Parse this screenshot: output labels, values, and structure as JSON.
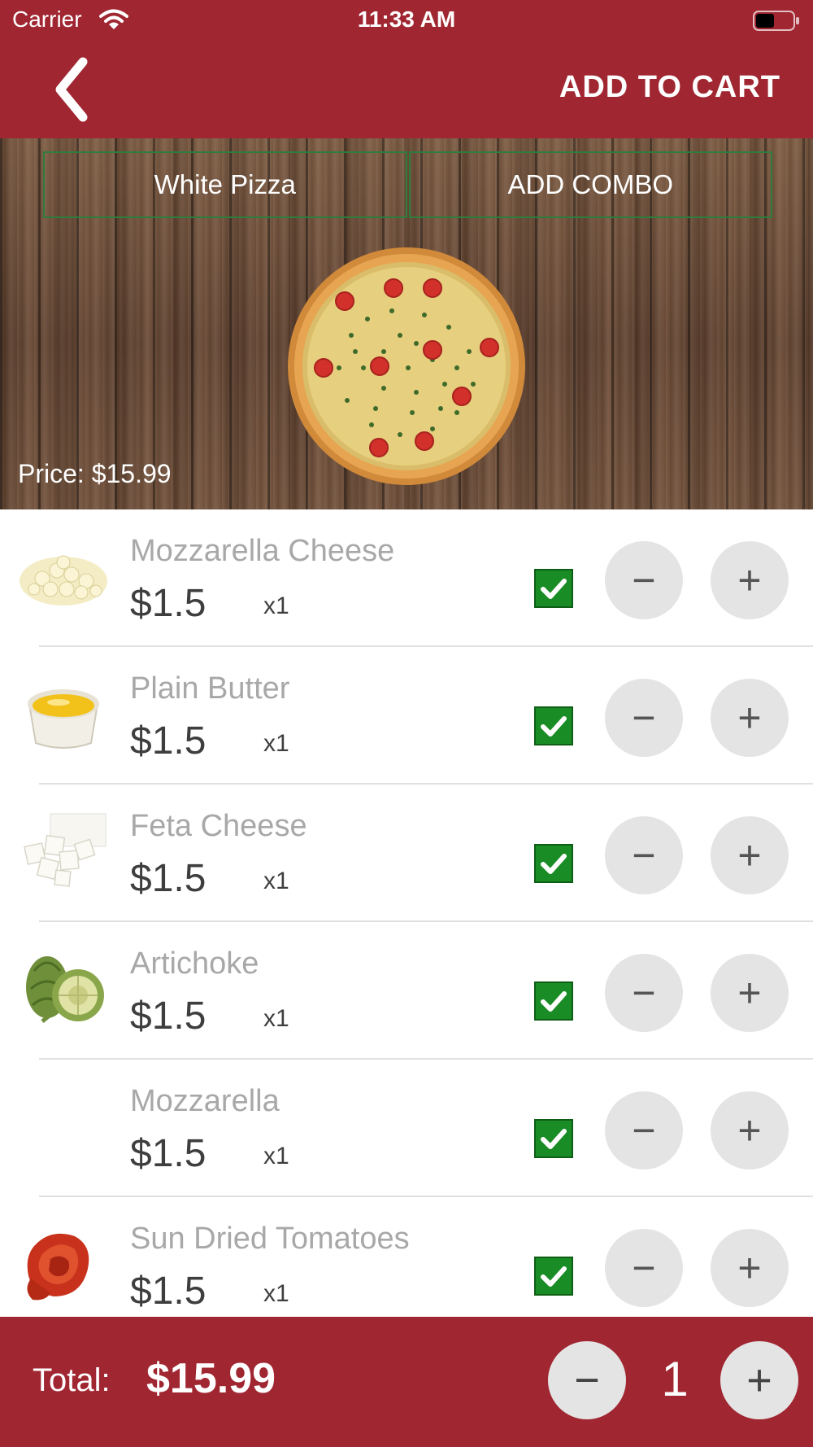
{
  "status_bar": {
    "carrier": "Carrier",
    "time": "11:33 AM"
  },
  "nav": {
    "add_to_cart": "ADD TO CART"
  },
  "hero": {
    "tabs": [
      {
        "label": "White Pizza"
      },
      {
        "label": "ADD COMBO"
      }
    ],
    "price": "Price: $15.99"
  },
  "toppings": [
    {
      "name": "Mozzarella Cheese",
      "price": "$1.5",
      "qty": "x1",
      "checked": true,
      "image": "mozzarella-cheese-image"
    },
    {
      "name": "Plain Butter",
      "price": "$1.5",
      "qty": "x1",
      "checked": true,
      "image": "butter-image"
    },
    {
      "name": "Feta Cheese",
      "price": "$1.5",
      "qty": "x1",
      "checked": true,
      "image": "feta-cheese-image"
    },
    {
      "name": "Artichoke",
      "price": "$1.5",
      "qty": "x1",
      "checked": true,
      "image": "artichoke-image"
    },
    {
      "name": "Mozzarella",
      "price": "$1.5",
      "qty": "x1",
      "checked": true,
      "image": ""
    },
    {
      "name": "Sun Dried Tomatoes",
      "price": "$1.5",
      "qty": "x1",
      "checked": true,
      "image": "sun-dried-tomatoes-image"
    }
  ],
  "buttons": {
    "minus": "−",
    "plus": "+"
  },
  "footer": {
    "total_label": "Total:",
    "total_value": "$15.99",
    "quantity": "1",
    "minus": "−",
    "plus": "+"
  },
  "colors": {
    "brand": "#a02631",
    "check": "#1a8c25",
    "tab_border": "#2e7d3c",
    "button_bg": "#e4e4e4"
  }
}
